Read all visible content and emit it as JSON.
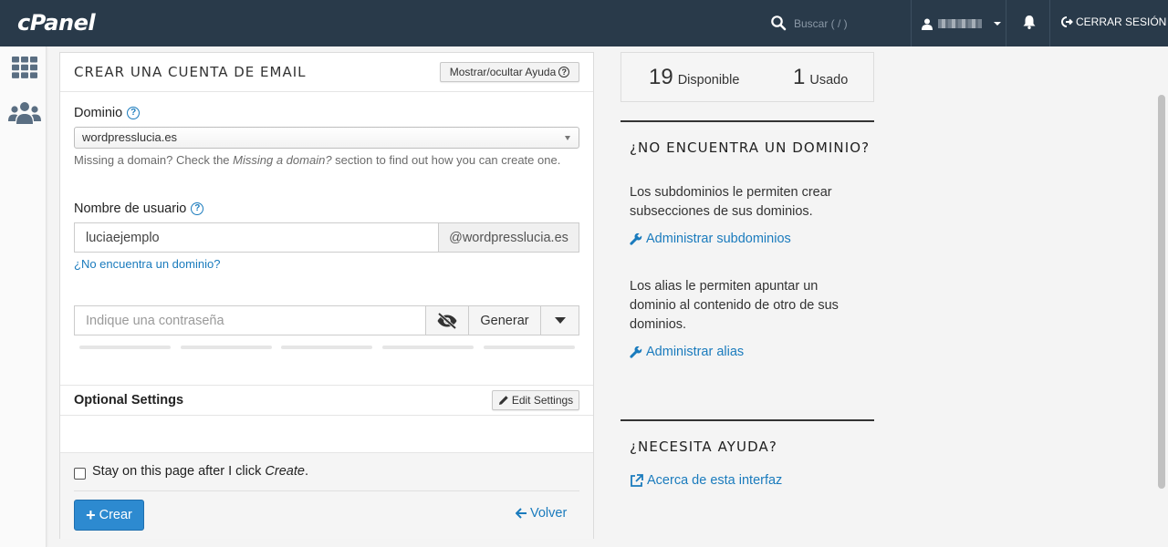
{
  "header": {
    "logo": "cPanel",
    "search_placeholder": "Buscar ( / )",
    "logout_label": "CERRAR SESIÓN"
  },
  "sidenav": {
    "icons": [
      "grid-icon",
      "users-icon"
    ]
  },
  "form": {
    "title": "CREAR UNA CUENTA DE EMAIL",
    "help_toggle_label": "Mostrar/ocultar Ayuda",
    "domain_label": "Dominio",
    "domain_selected": "wordpresslucia.es",
    "domain_hint_prefix": "Missing a domain? Check the ",
    "domain_hint_em": "Missing a domain?",
    "domain_hint_suffix": " section to find out how you can create one.",
    "username_label": "Nombre de usuario",
    "username_value": "luciaejemplo",
    "username_suffix": "@wordpresslucia.es",
    "no_domain_link": "¿No encuentra un dominio?",
    "password_placeholder": "Indique una contraseña",
    "generate_label": "Generar",
    "optional_settings_title": "Optional Settings",
    "edit_settings_label": "Edit Settings",
    "stay_label_prefix": "Stay on this page after I click ",
    "stay_label_em": "Create",
    "stay_label_suffix": ".",
    "create_label": "Crear",
    "back_label": "Volver"
  },
  "stats": {
    "available_count": "19",
    "available_label": "Disponible",
    "used_count": "1",
    "used_label": "Usado"
  },
  "sidebar_help": {
    "no_domain_heading": "¿NO ENCUENTRA UN DOMINIO?",
    "subdomains_text": "Los subdominios le permiten crear subsecciones de sus dominios.",
    "subdomains_link": "Administrar subdominios",
    "alias_text": "Los alias le permiten apuntar un dominio al contenido de otro de sus dominios.",
    "alias_link": "Administrar alias",
    "need_help_heading": "¿NECESITA AYUDA?",
    "about_link": "Acerca de esta interfaz"
  },
  "colors": {
    "topbar": "#293a4a",
    "accent": "#1a7bbd",
    "primary_button": "#2d8ad0"
  }
}
